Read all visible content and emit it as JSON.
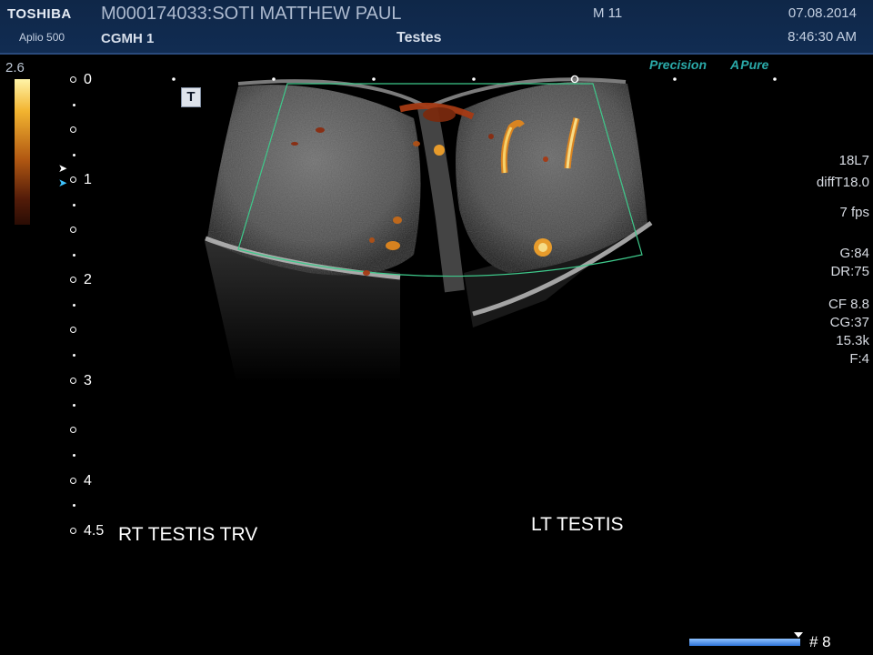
{
  "header": {
    "brand": "TOSHIBA",
    "model": "Aplio 500",
    "patient": "M000174033:SOTI MATTHEW PAUL",
    "hospital": "CGMH 1",
    "mode": "M 11",
    "exam": "Testes",
    "date": "07.08.2014",
    "time": "8:46:30 AM"
  },
  "colorbar": {
    "max_value": "2.6",
    "colors": [
      "#fff4a8",
      "#f2b430",
      "#b15812",
      "#541c09"
    ]
  },
  "depth_scale": {
    "labels": [
      "0",
      "1",
      "2",
      "3",
      "4",
      "4.5"
    ]
  },
  "features": {
    "precision": "Precision",
    "apure_a": "A",
    "apure_rest": "Pure"
  },
  "image_marker": "T",
  "parameters": {
    "probe": "18L7",
    "preset": "diffT18.0",
    "fps": "7 fps",
    "gain": "G:84",
    "dynamic_range": "DR:75",
    "color_freq": "CF 8.8",
    "color_gain": "CG:37",
    "prf": "15.3k",
    "filter": "F:4"
  },
  "annotations": {
    "right_testis": "RT TESTIS TRV",
    "left_testis": "LT TESTIS"
  },
  "cine": {
    "frame": "# 8"
  },
  "accent_colors": {
    "header_bg": "#112c52",
    "teal_text": "#2aa9a8",
    "roi_box": "#3ec98b",
    "probe_bar": "#2e74d8"
  }
}
